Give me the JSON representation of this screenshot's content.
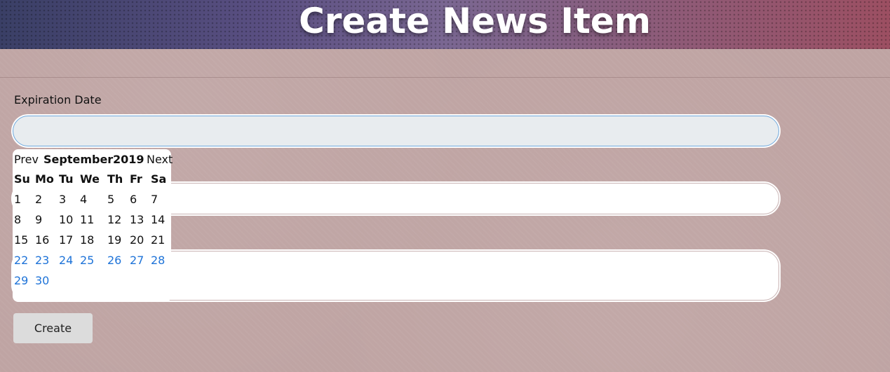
{
  "header": {
    "title": "Create News Item"
  },
  "form": {
    "expiration_label": "Expiration Date",
    "expiration_value": "",
    "title_value": "",
    "body_value": "",
    "create_label": "Create"
  },
  "datepicker": {
    "prev_label": "Prev",
    "next_label": "Next",
    "month": "September",
    "year": "2019",
    "weekdays": [
      "Su",
      "Mo",
      "Tu",
      "We",
      "Th",
      "Fr",
      "Sa"
    ],
    "weeks": [
      [
        "1",
        "2",
        "3",
        "4",
        "5",
        "6",
        "7"
      ],
      [
        "8",
        "9",
        "10",
        "11",
        "12",
        "13",
        "14"
      ],
      [
        "15",
        "16",
        "17",
        "18",
        "19",
        "20",
        "21"
      ],
      [
        "22",
        "23",
        "24",
        "25",
        "26",
        "27",
        "28"
      ],
      [
        "29",
        "30",
        "",
        "",
        "",
        "",
        ""
      ]
    ],
    "selectable_from_week": 3,
    "link_color": "#1e73d8"
  }
}
